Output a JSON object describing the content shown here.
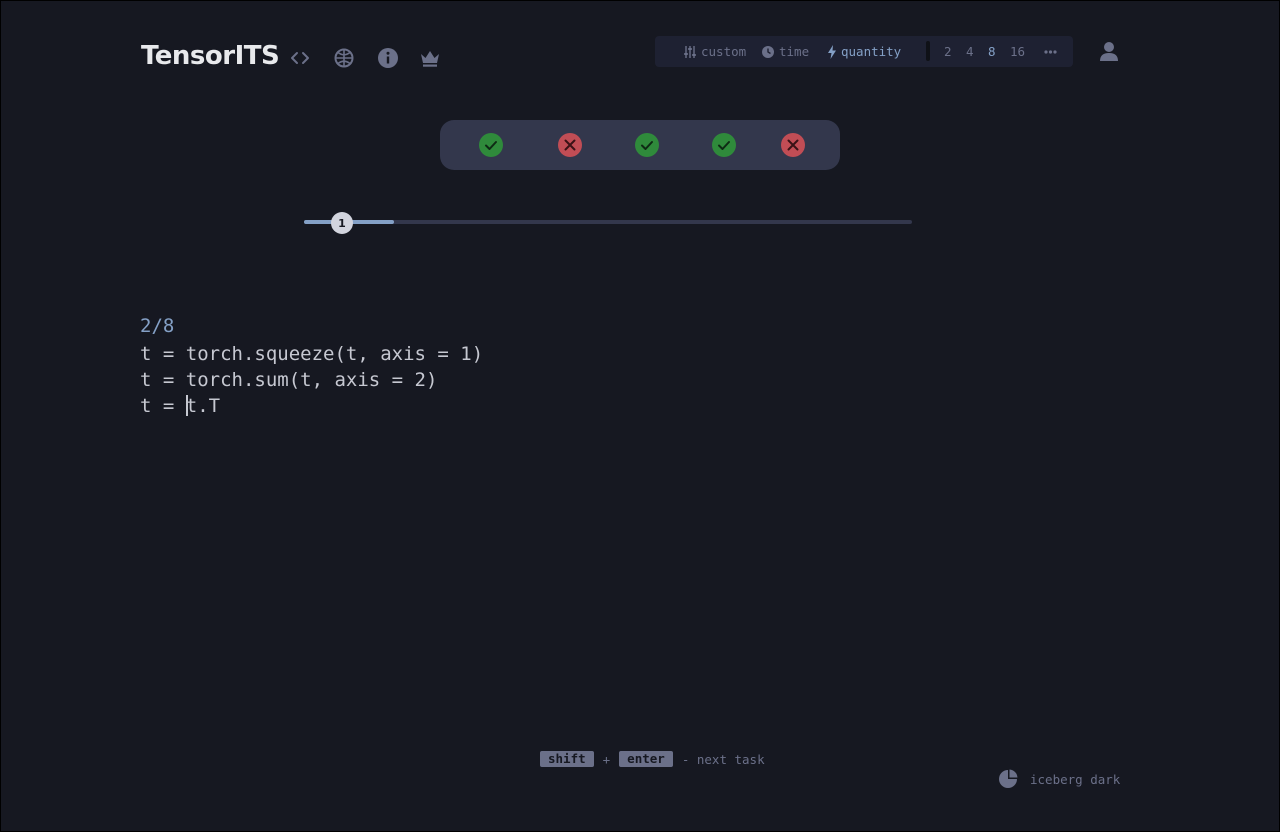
{
  "app": {
    "title": "TensorITS"
  },
  "nav": [
    "code-icon",
    "globe-icon",
    "info-icon",
    "crown-icon"
  ],
  "config": {
    "modes": [
      {
        "icon": "sliders-icon",
        "label": "custom",
        "active": false
      },
      {
        "icon": "clock-icon",
        "label": "time",
        "active": false
      },
      {
        "icon": "bolt-icon",
        "label": "quantity",
        "active": true
      }
    ],
    "counts": [
      {
        "label": "2",
        "active": false
      },
      {
        "label": "4",
        "active": false
      },
      {
        "label": "8",
        "active": true
      },
      {
        "label": "16",
        "active": false
      }
    ],
    "more_icon": "ellipsis-icon"
  },
  "results": [
    "correct",
    "wrong",
    "correct",
    "correct",
    "wrong"
  ],
  "slider": {
    "value_label": "1",
    "fill_fraction": 0.148
  },
  "task": {
    "counter": "2/8",
    "lines": [
      "t = torch.squeeze(t, axis = 1)",
      "t = torch.sum(t, axis = 2)"
    ],
    "input_prefix": "t = ",
    "input_value": "t.T"
  },
  "hint": {
    "key1": "shift",
    "plus": "+",
    "key2": "enter",
    "action": "- next task"
  },
  "theme": {
    "name": "iceberg dark"
  },
  "colors": {
    "background": "#161821",
    "accent": "#84a0c6",
    "correct": "#2f8a3b",
    "wrong": "#c14d55"
  }
}
